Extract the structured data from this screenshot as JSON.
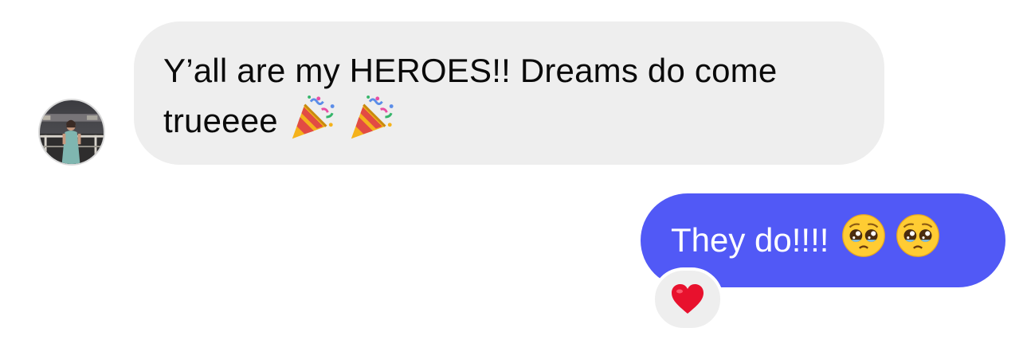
{
  "messages": [
    {
      "direction": "incoming",
      "line1": "Y’all are my HEROES!! Dreams do come",
      "line2": "trueeee",
      "emojis": [
        "party-popper-icon",
        "party-popper-icon"
      ],
      "bubble_color": "#eeeeee"
    },
    {
      "direction": "outgoing",
      "text": "They do!!!!",
      "emojis": [
        "pleading-face-icon",
        "pleading-face-icon"
      ],
      "bubble_color": "#5159f6",
      "reaction": "red-heart-icon"
    }
  ],
  "colors": {
    "background": "#ffffff",
    "incoming_text": "#0a0a0a",
    "outgoing_text": "#ffffff",
    "reaction_heart": "#e8112d"
  }
}
